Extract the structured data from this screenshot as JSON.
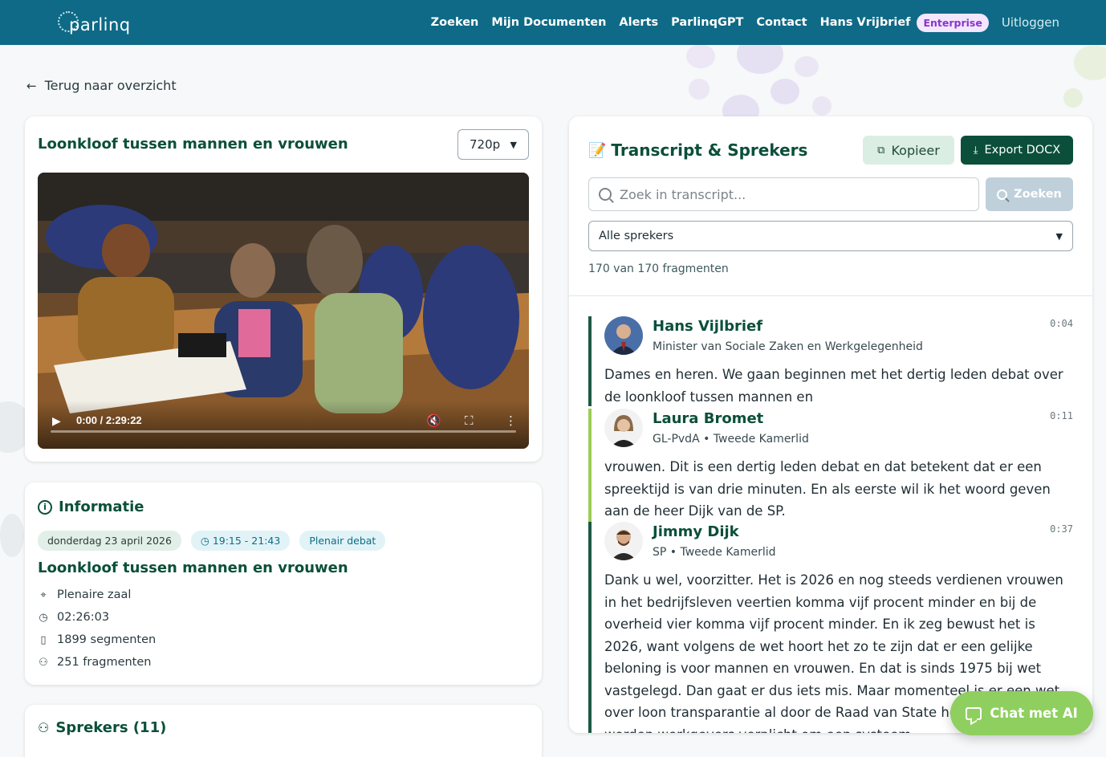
{
  "colors": {
    "navbar": "#0e6a86",
    "brand_green": "#0b4f3a",
    "accent_lime": "#8fcf5f",
    "bar_hans": "#1c5a43",
    "bar_laura": "#9ccd55",
    "bar_jimmy": "#1c5a43"
  },
  "nav": {
    "logo": "parlinq",
    "links": [
      "Zoeken",
      "Mijn Documenten",
      "Alerts",
      "ParlinqGPT",
      "Contact"
    ],
    "user": "Hans Vrijbrief",
    "badge": "Enterprise",
    "logout": "Uitloggen"
  },
  "back": {
    "label": "Terug naar overzicht",
    "icon": "arrow-left-icon"
  },
  "video": {
    "title": "Loonkloof tussen mannen en vrouwen",
    "quality": "720p",
    "time": "0:00 / 2:29:22",
    "progress": 0
  },
  "info": {
    "heading": "Informatie",
    "date": "donderdag 23 april 2026",
    "time_range": "19:15 - 21:43",
    "type": "Plenair debat",
    "title": "Loonkloof tussen mannen en vrouwen",
    "location": "Plenaire zaal",
    "duration": "02:26:03",
    "segments": "1899 segmenten",
    "fragments": "251 fragmenten"
  },
  "speakers_section": {
    "heading": "Sprekers (11)"
  },
  "transcript": {
    "emoji": "📝",
    "title": "Transcript & Sprekers",
    "copy_label": "Kopieer",
    "export_label": "Export DOCX",
    "search_placeholder": "Zoek in transcript...",
    "search_button": "Zoeken",
    "speaker_filter": "Alle sprekers",
    "count": "170 van 170 fragmenten",
    "entries": [
      {
        "name": "Hans Vijlbrief",
        "role": "Minister van Sociale Zaken en Werkgelegenheid",
        "timestamp": "0:04",
        "text": "Dames en heren. We gaan beginnen met het dertig leden debat over de loonkloof tussen mannen en"
      },
      {
        "name": "Laura Bromet",
        "role": "GL-PvdA • Tweede Kamerlid",
        "timestamp": "0:11",
        "text": "vrouwen. Dit is een dertig leden debat en dat betekent dat er een spreektijd is van drie minuten. En als eerste wil ik het woord geven aan de heer Dijk van de SP."
      },
      {
        "name": "Jimmy Dijk",
        "role": "SP • Tweede Kamerlid",
        "timestamp": "0:37",
        "text": "Dank u wel, voorzitter. Het is 2026 en nog steeds verdienen vrouwen in het bedrijfsleven veertien komma vijf procent minder en bij de overheid vier komma vijf procent minder. En ik zeg bewust het is 2026, want volgens de wet hoort het zo te zijn dat er een gelijke beloning is voor mannen en vrouwen. En dat is sinds 1975 bij wet vastgelegd. Dan gaat er dus iets mis. Maar momenteel is er een wet over loon transparantie al door de Raad van State heen, waarbij worden werkgevers verplicht om een systeem"
      }
    ]
  },
  "chat": {
    "label": "Chat met AI"
  }
}
